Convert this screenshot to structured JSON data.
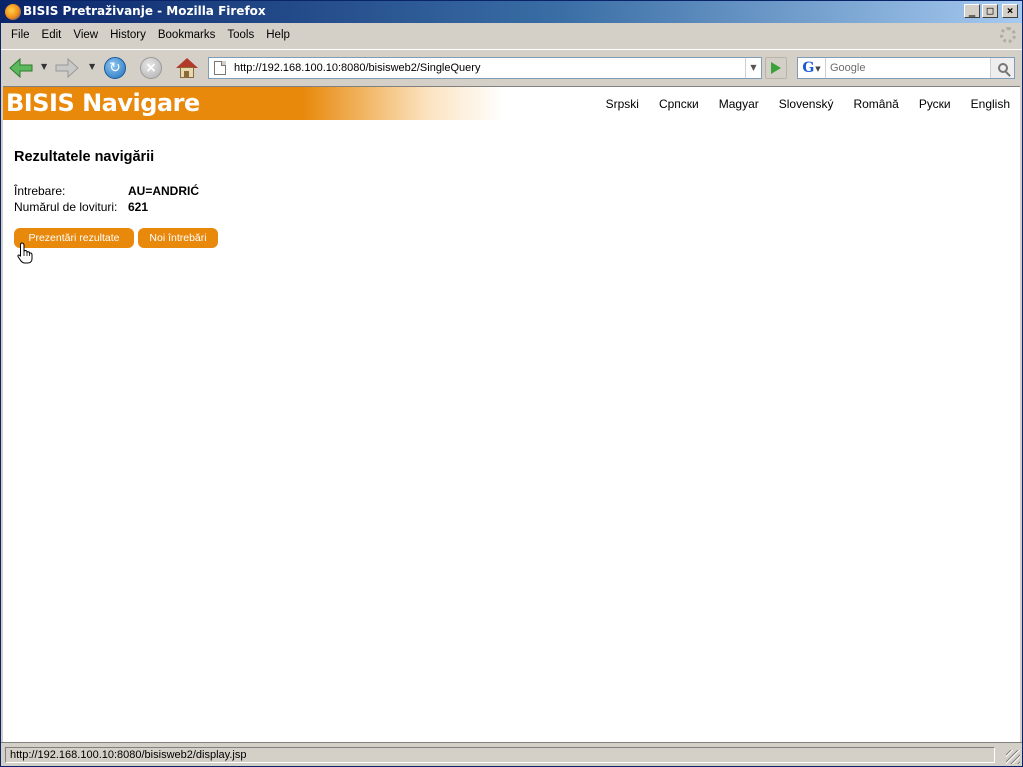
{
  "window": {
    "title": "BISIS Pretraživanje - Mozilla Firefox",
    "minimize_glyph": "_",
    "maximize_glyph": "□",
    "close_glyph": "×"
  },
  "menu": [
    "File",
    "Edit",
    "View",
    "History",
    "Bookmarks",
    "Tools",
    "Help"
  ],
  "nav": {
    "url": "http://192.168.100.10:8080/bisisweb2/SingleQuery",
    "search_placeholder": "Google",
    "search_engine_glyph": "G"
  },
  "page": {
    "banner_title": "BISIS Navigare",
    "languages": [
      "Srpski",
      "Српски",
      "Magyar",
      "Slovenský",
      "Română",
      "Руски",
      "English"
    ],
    "heading": "Rezultatele navigării",
    "query_label": "Întrebare:",
    "query_value": "AU=ANDRIĆ",
    "hits_label": "Numărul de lovituri:",
    "hits_value": "621",
    "present_button": "Prezentări rezultate",
    "new_query_button": "Noi întrebări"
  },
  "status": {
    "text": "http://192.168.100.10:8080/bisisweb2/display.jsp"
  },
  "colors": {
    "brand_orange": "#e8890b",
    "titlebar_blue": "#0a246a"
  }
}
